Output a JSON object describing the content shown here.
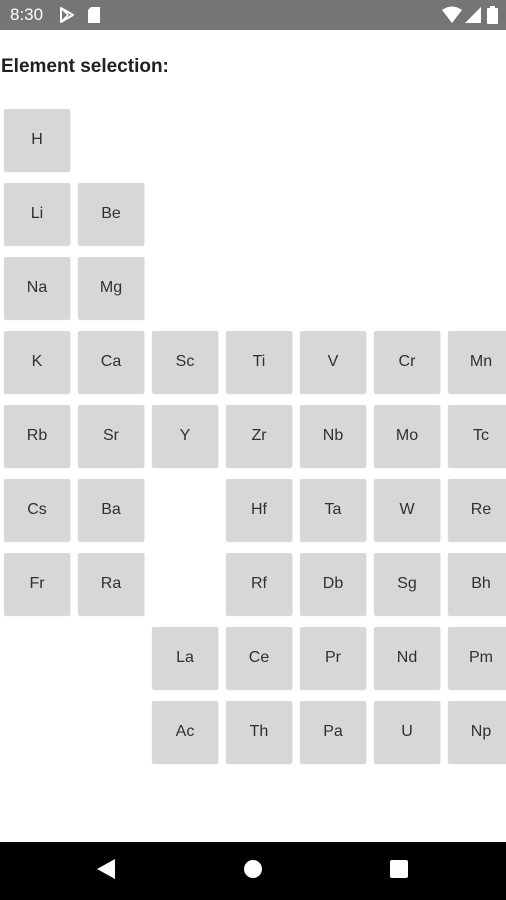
{
  "status_bar": {
    "time": "8:30",
    "icons": [
      "play-store-icon",
      "sd-card-icon",
      "wifi-icon",
      "cell-signal-icon",
      "battery-icon"
    ]
  },
  "title": "Element selection:",
  "elements": [
    {
      "symbol": "H",
      "row": 0,
      "col": 0
    },
    {
      "symbol": "Li",
      "row": 1,
      "col": 0
    },
    {
      "symbol": "Be",
      "row": 1,
      "col": 1
    },
    {
      "symbol": "Na",
      "row": 2,
      "col": 0
    },
    {
      "symbol": "Mg",
      "row": 2,
      "col": 1
    },
    {
      "symbol": "K",
      "row": 3,
      "col": 0
    },
    {
      "symbol": "Ca",
      "row": 3,
      "col": 1
    },
    {
      "symbol": "Sc",
      "row": 3,
      "col": 2
    },
    {
      "symbol": "Ti",
      "row": 3,
      "col": 3
    },
    {
      "symbol": "V",
      "row": 3,
      "col": 4
    },
    {
      "symbol": "Cr",
      "row": 3,
      "col": 5
    },
    {
      "symbol": "Mn",
      "row": 3,
      "col": 6
    },
    {
      "symbol": "Rb",
      "row": 4,
      "col": 0
    },
    {
      "symbol": "Sr",
      "row": 4,
      "col": 1
    },
    {
      "symbol": "Y",
      "row": 4,
      "col": 2
    },
    {
      "symbol": "Zr",
      "row": 4,
      "col": 3
    },
    {
      "symbol": "Nb",
      "row": 4,
      "col": 4
    },
    {
      "symbol": "Mo",
      "row": 4,
      "col": 5
    },
    {
      "symbol": "Tc",
      "row": 4,
      "col": 6
    },
    {
      "symbol": "Cs",
      "row": 5,
      "col": 0
    },
    {
      "symbol": "Ba",
      "row": 5,
      "col": 1
    },
    {
      "symbol": "Hf",
      "row": 5,
      "col": 3
    },
    {
      "symbol": "Ta",
      "row": 5,
      "col": 4
    },
    {
      "symbol": "W",
      "row": 5,
      "col": 5
    },
    {
      "symbol": "Re",
      "row": 5,
      "col": 6
    },
    {
      "symbol": "Fr",
      "row": 6,
      "col": 0
    },
    {
      "symbol": "Ra",
      "row": 6,
      "col": 1
    },
    {
      "symbol": "Rf",
      "row": 6,
      "col": 3
    },
    {
      "symbol": "Db",
      "row": 6,
      "col": 4
    },
    {
      "symbol": "Sg",
      "row": 6,
      "col": 5
    },
    {
      "symbol": "Bh",
      "row": 6,
      "col": 6
    },
    {
      "symbol": "La",
      "row": 7,
      "col": 2
    },
    {
      "symbol": "Ce",
      "row": 7,
      "col": 3
    },
    {
      "symbol": "Pr",
      "row": 7,
      "col": 4
    },
    {
      "symbol": "Nd",
      "row": 7,
      "col": 5
    },
    {
      "symbol": "Pm",
      "row": 7,
      "col": 6
    },
    {
      "symbol": "Ac",
      "row": 8,
      "col": 2
    },
    {
      "symbol": "Th",
      "row": 8,
      "col": 3
    },
    {
      "symbol": "Pa",
      "row": 8,
      "col": 4
    },
    {
      "symbol": "U",
      "row": 8,
      "col": 5
    },
    {
      "symbol": "Np",
      "row": 8,
      "col": 6
    }
  ],
  "nav_bar": {
    "icons": [
      "back-icon",
      "home-icon",
      "recents-icon"
    ]
  }
}
